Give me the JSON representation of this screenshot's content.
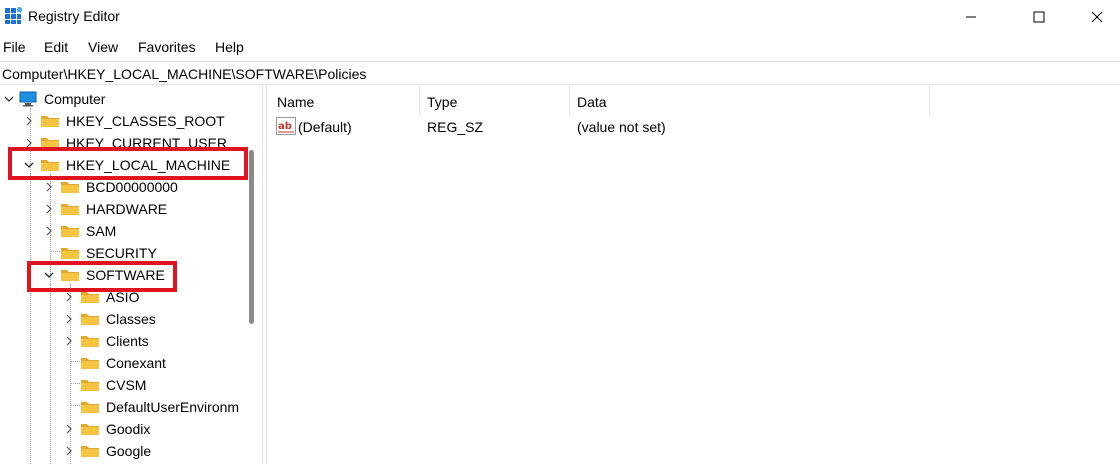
{
  "window": {
    "title": "Registry Editor",
    "app_icon": "registry-icon",
    "buttons": [
      "minimize-icon",
      "maximize-icon",
      "close-icon"
    ]
  },
  "menu": [
    "File",
    "Edit",
    "View",
    "Favorites",
    "Help"
  ],
  "address": "Computer\\HKEY_LOCAL_MACHINE\\SOFTWARE\\Policies",
  "tree": {
    "root": "Computer",
    "items": [
      {
        "label": "HKEY_CLASSES_ROOT",
        "expander": "collapsed"
      },
      {
        "label": "HKEY_CURRENT_USER",
        "expander": "collapsed"
      },
      {
        "label": "HKEY_LOCAL_MACHINE",
        "expander": "expanded",
        "highlighted": true
      },
      {
        "label": "BCD00000000",
        "expander": "collapsed"
      },
      {
        "label": "HARDWARE",
        "expander": "collapsed"
      },
      {
        "label": "SAM",
        "expander": "collapsed"
      },
      {
        "label": "SECURITY",
        "expander": "none"
      },
      {
        "label": "SOFTWARE",
        "expander": "expanded",
        "highlighted": true
      },
      {
        "label": "ASIO",
        "expander": "collapsed"
      },
      {
        "label": "Classes",
        "expander": "collapsed"
      },
      {
        "label": "Clients",
        "expander": "collapsed"
      },
      {
        "label": "Conexant",
        "expander": "none"
      },
      {
        "label": "CVSM",
        "expander": "none"
      },
      {
        "label": "DefaultUserEnvironm",
        "expander": "none"
      },
      {
        "label": "Goodix",
        "expander": "collapsed"
      },
      {
        "label": "Google",
        "expander": "collapsed"
      }
    ]
  },
  "values": {
    "columns": [
      "Name",
      "Type",
      "Data"
    ],
    "rows": [
      {
        "name": "(Default)",
        "type": "REG_SZ",
        "data": "(value not set)",
        "icon": "string-value-icon"
      }
    ]
  },
  "colors": {
    "highlight": "#e0141f",
    "folder": "#f5c542"
  }
}
